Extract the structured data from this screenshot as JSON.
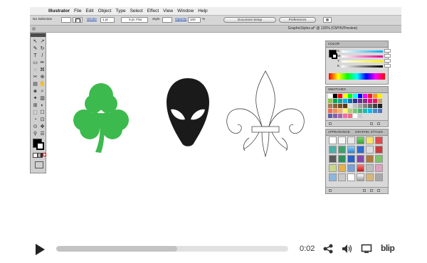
{
  "menubar": {
    "apple_glyph": "",
    "app_name": "Illustrator",
    "menus": [
      "File",
      "Edit",
      "Object",
      "Type",
      "Select",
      "Effect",
      "View",
      "Window",
      "Help"
    ]
  },
  "controlbar": {
    "selection": "No Selection",
    "stroke_label": "Stroke",
    "stroke_value": "1 pt",
    "brush_value": "5 pt. Flat",
    "style_label": "Style",
    "opacity_label": "Opacity",
    "opacity_value": "100",
    "opacity_unit": "%",
    "document_setup": "Document Setup",
    "preferences": "Preferences"
  },
  "document": {
    "tab_title": "GraphicStyles.ai* @ 125% (CMYK/Preview)"
  },
  "panels": {
    "color_title": "COLOR",
    "color_channels": [
      "C",
      "M",
      "Y",
      "K"
    ],
    "swatches_title": "SWATCHES",
    "appearance_tab": "APPEARANCE",
    "graphic_styles_tab": "GRAPHIC STYLES"
  },
  "artwork": {
    "shamrock_color": "#3dba4e",
    "alien_color": "#1a1a1a"
  },
  "player": {
    "time": "0:02",
    "progress": 0.52,
    "brand": "blip"
  }
}
